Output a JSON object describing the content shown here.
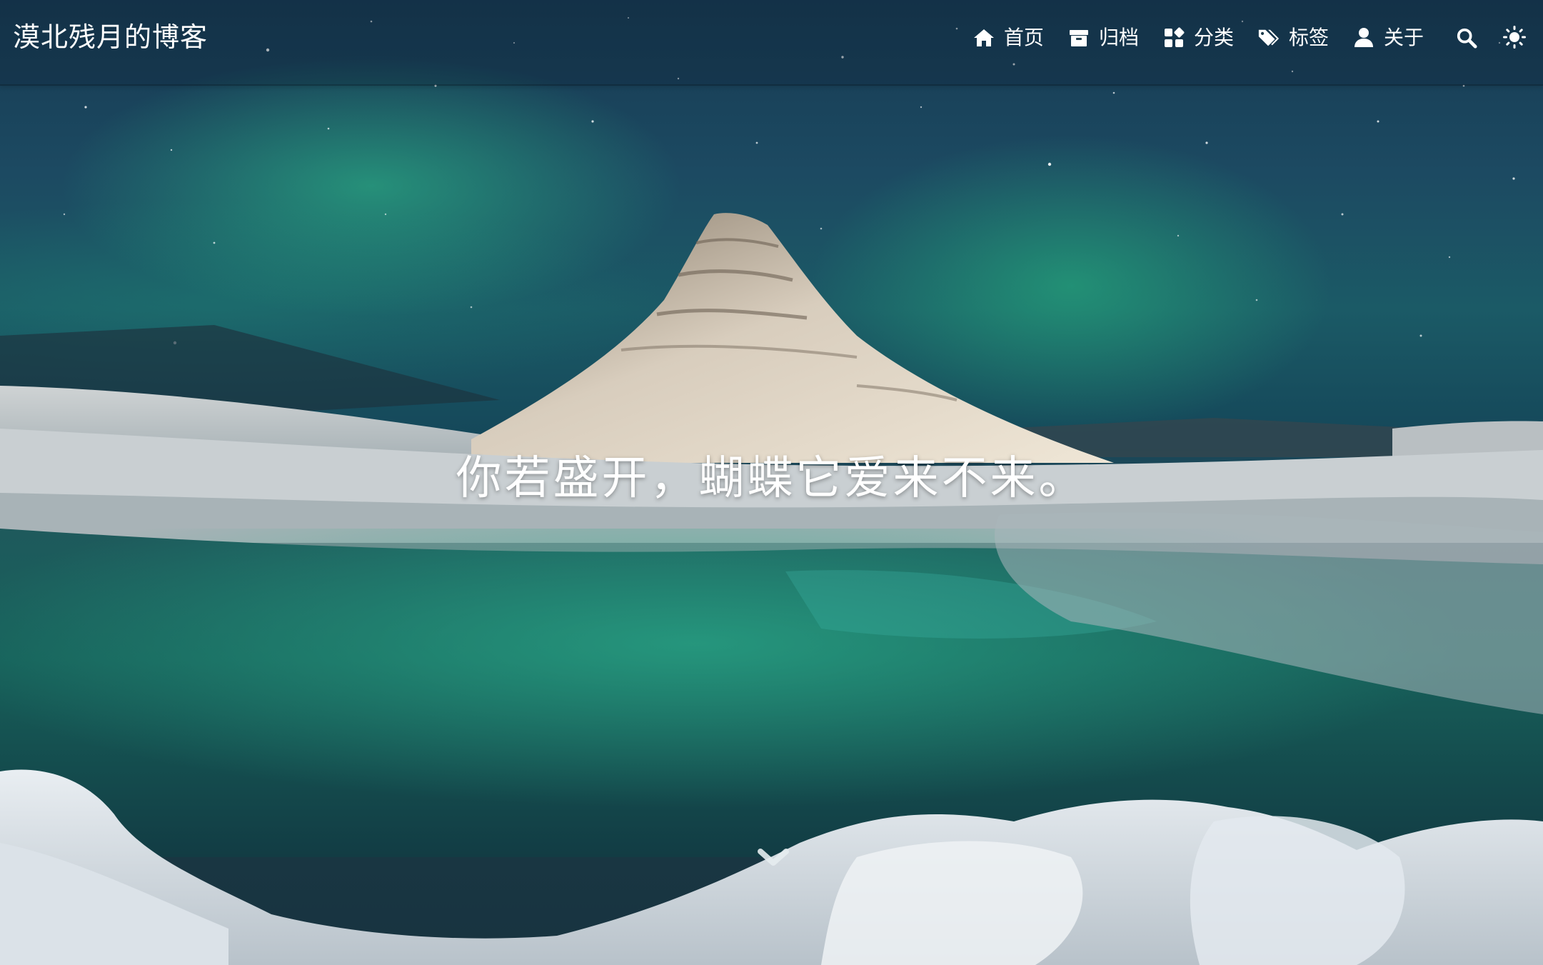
{
  "brand": {
    "title": "漠北残月的博客"
  },
  "nav": {
    "items": [
      {
        "label": "首页",
        "icon": "home-icon"
      },
      {
        "label": "归档",
        "icon": "archive-icon"
      },
      {
        "label": "分类",
        "icon": "category-icon"
      },
      {
        "label": "标签",
        "icon": "tags-icon"
      },
      {
        "label": "关于",
        "icon": "user-icon"
      }
    ],
    "search_icon": "search-icon",
    "theme_icon": "sun-icon"
  },
  "hero": {
    "slogan": "你若盛开，蝴蝶它爱来不来。",
    "scroll_icon": "chevron-down-icon"
  },
  "colors": {
    "text": "#ffffff",
    "aurora": "#2ec88c",
    "sky": "#173a52",
    "snow": "#d9dfe3"
  }
}
